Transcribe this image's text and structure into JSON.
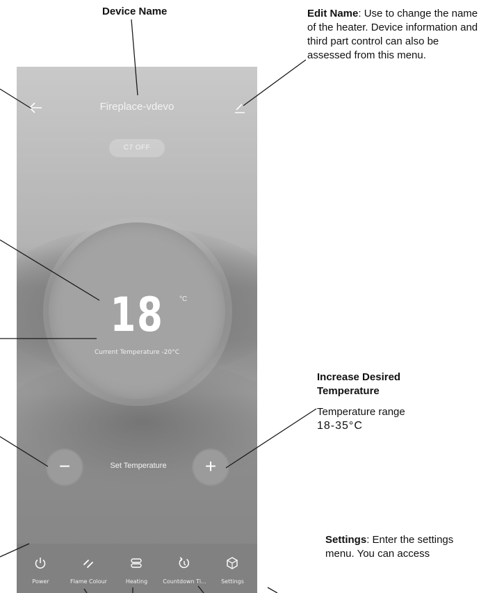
{
  "callouts": {
    "device_name": "Device Name",
    "edit_name_heading": "Edit Name",
    "edit_name_text": ": Use to change the name of the heater. Device information and third part control can also be assessed from this menu.",
    "increase_heading": "Increase Desired Temperature",
    "increase_text": "Temperature range",
    "increase_range": "18-35°C",
    "settings_heading": "Settings",
    "settings_text": ": Enter the settings menu. You can access"
  },
  "app": {
    "title": "Fireplace-vdevo",
    "status": "C7  OFF",
    "target_temp": "18",
    "unit": "°C",
    "current_temp": "Current Temperature -20°C",
    "set_temp_label": "Set Temperature",
    "minus": "−",
    "plus": "+"
  },
  "tabs": [
    {
      "label": "Power",
      "icon": "power-icon"
    },
    {
      "label": "Flame Colour",
      "icon": "flame-colour-icon"
    },
    {
      "label": "Heating",
      "icon": "heating-icon"
    },
    {
      "label": "Countdown Ti...",
      "icon": "countdown-icon"
    },
    {
      "label": "Settings",
      "icon": "settings-icon"
    }
  ],
  "colors": {
    "screen_dark": "#818181",
    "dial": "#a3a3a3",
    "text_light": "#ffffff"
  }
}
